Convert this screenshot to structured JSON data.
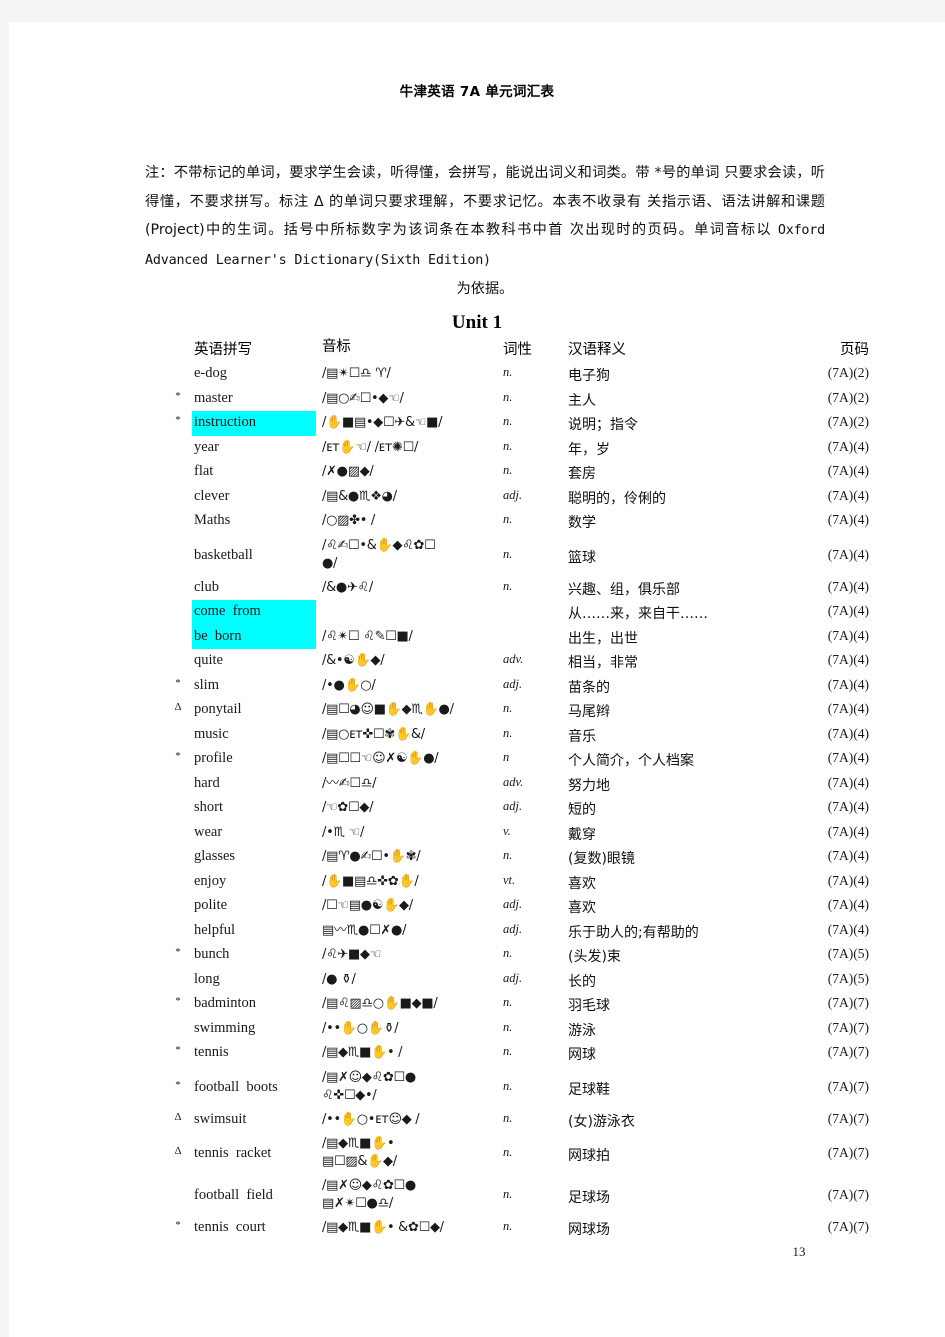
{
  "document": {
    "title": "牛津英语 7A 单元词汇表",
    "page_number": "13",
    "note": {
      "line1": "注：不带标记的单词，要求学生会读，听得懂，会拼写，能说出词义和词类。带 *号的单词",
      "line2": "只要求会读，听得懂，不要求拼写。标注 Δ 的单词只要求理解，不要求记忆。本表不收录有",
      "line3": "关指示语、语法讲解和课题(Project)中的生词。括号中所标数字为该词条在本教科书中首",
      "line4_pre": "次出现时的页码。单词音标以 ",
      "line4_mono": "Oxford Advanced Learner's Dictionary(Sixth Edition)",
      "line5": "为依据。"
    }
  },
  "unit": {
    "heading": "Unit 1"
  },
  "table": {
    "headers": {
      "mark": "",
      "word": "英语拼写",
      "phonetic": "音标",
      "pos": "词性",
      "meaning": "汉语释义",
      "page": "页码"
    },
    "highlight_color": "#00ffff",
    "rows": [
      {
        "mark": "",
        "word": "e-dog",
        "phonetic": "/▤✴☐♎  ♈/",
        "pos": "n.",
        "meaning": "电子狗",
        "page": "(7A)(2)",
        "highlight": false
      },
      {
        "mark": "*",
        "word": "master",
        "phonetic": "/▤○✍☐•◆☜/",
        "pos": "n.",
        "meaning": "主人",
        "page": "(7A)(2)",
        "highlight": false
      },
      {
        "mark": "*",
        "word": "instruction",
        "phonetic": "/✋■▤•◆☐✈&☜■/",
        "pos": "n.",
        "meaning": "说明；指令",
        "page": "(7A)(2)",
        "highlight": true
      },
      {
        "mark": "",
        "word": "year",
        "phonetic": "/ᴇᴛ✋☜/ /ᴇᴛ✺☐/",
        "pos": "n.",
        "meaning": "年，岁",
        "page": "(7A)(4)",
        "highlight": false
      },
      {
        "mark": "",
        "word": "flat",
        "phonetic": "/✗●▨◆/",
        "pos": "n.",
        "meaning": "套房",
        "page": "(7A)(4)",
        "highlight": false
      },
      {
        "mark": "",
        "word": "clever",
        "phonetic": "/▤&●♏❖◕/",
        "pos": "adj.",
        "meaning": "聪明的，伶俐的",
        "page": "(7A)(4)",
        "highlight": false
      },
      {
        "mark": "",
        "word": "Maths",
        "phonetic": "/○▨✤• /",
        "pos": "n.",
        "meaning": "数学",
        "page": "(7A)(4)",
        "highlight": false
      },
      {
        "mark": "",
        "word": "basketball",
        "phonetic": "/♌✍☐•&✋◆♌✿☐\n●/",
        "pos": "n.",
        "meaning": "篮球",
        "page": "(7A)(4)",
        "highlight": false
      },
      {
        "mark": "",
        "word": "club",
        "phonetic": "/&●✈♌/",
        "pos": "n.",
        "meaning": "兴趣、组，俱乐部",
        "page": "(7A)(4)",
        "highlight": false
      },
      {
        "mark": "",
        "word": "come  from",
        "phonetic": "",
        "pos": "",
        "meaning": "从……来，来自干……",
        "page": "(7A)(4)",
        "highlight": true
      },
      {
        "mark": "",
        "word": "be  born",
        "phonetic": "/♌✴☐ ♌✎☐■/",
        "pos": "",
        "meaning": "出生，出世",
        "page": "(7A)(4)",
        "highlight": true
      },
      {
        "mark": "",
        "word": "quite",
        "phonetic": "/&•☯✋◆/",
        "pos": "adv.",
        "meaning": "相当，非常",
        "page": "(7A)(4)",
        "highlight": false
      },
      {
        "mark": "*",
        "word": "slim",
        "phonetic": "/•●✋○/",
        "pos": "adj.",
        "meaning": "苗条的",
        "page": "(7A)(4)",
        "highlight": false
      },
      {
        "mark": "Δ",
        "word": "ponytail",
        "phonetic": "/▤☐◕☺■✋◆♏✋●/",
        "pos": "n.",
        "meaning": "马尾辫",
        "page": "(7A)(4)",
        "highlight": false
      },
      {
        "mark": "",
        "word": "music",
        "phonetic": "/▤○ᴇᴛ✜☐✾✋&/",
        "pos": "n.",
        "meaning": "音乐",
        "page": "(7A)(4)",
        "highlight": false
      },
      {
        "mark": "*",
        "word": "profile",
        "phonetic": "/▤☐☐☜☺✗☯✋●/",
        "pos": "n",
        "meaning": "个人简介，个人档案",
        "page": "(7A)(4)",
        "highlight": false
      },
      {
        "mark": "",
        "word": "hard",
        "phonetic": "/〰✍☐♎/",
        "pos": "adv.",
        "meaning": "努力地",
        "page": "(7A)(4)",
        "highlight": false
      },
      {
        "mark": "",
        "word": "short",
        "phonetic": "/☜✿☐◆/",
        "pos": "adj.",
        "meaning": "短的",
        "page": "(7A)(4)",
        "highlight": false
      },
      {
        "mark": "",
        "word": "wear",
        "phonetic": "/•♏ ☜/",
        "pos": "v.",
        "meaning": "戴穿",
        "page": "(7A)(4)",
        "highlight": false
      },
      {
        "mark": "",
        "word": "glasses",
        "phonetic": "/▤♈●✍☐•✋✾/",
        "pos": "n.",
        "meaning": "(复数)眼镜",
        "page": "(7A)(4)",
        "highlight": false
      },
      {
        "mark": "",
        "word": "enjoy",
        "phonetic": "/✋■▤♎✜✿✋/",
        "pos": "vt.",
        "meaning": "喜欢",
        "page": "(7A)(4)",
        "highlight": false
      },
      {
        "mark": "",
        "word": "polite",
        "phonetic": "/☐☜▤●☯✋◆/",
        "pos": "adj.",
        "meaning": "喜欢",
        "page": "(7A)(4)",
        "highlight": false
      },
      {
        "mark": "",
        "word": "helpful",
        "phonetic": "▤〰♏●☐✗●/",
        "pos": "adj.",
        "meaning": "乐于助人的;有帮助的",
        "page": "(7A)(4)",
        "highlight": false
      },
      {
        "mark": "*",
        "word": "bunch",
        "phonetic": "/♌✈■◆☜",
        "pos": "n.",
        "meaning": "(头发)束",
        "page": "(7A)(5)",
        "highlight": false
      },
      {
        "mark": "",
        "word": "long",
        "phonetic": "/●  ⚱/",
        "pos": "adj.",
        "meaning": "长的",
        "page": "(7A)(5)",
        "highlight": false
      },
      {
        "mark": "*",
        "word": "badminton",
        "phonetic": "/▤♌▨♎○✋■◆■/",
        "pos": "n.",
        "meaning": "羽毛球",
        "page": "(7A)(7)",
        "highlight": false
      },
      {
        "mark": "",
        "word": "swimming",
        "phonetic": "/••✋○✋⚱/",
        "pos": "n.",
        "meaning": "游泳",
        "page": "(7A)(7)",
        "highlight": false
      },
      {
        "mark": "*",
        "word": "tennis",
        "phonetic": "/▤◆♏■✋• /",
        "pos": "n.",
        "meaning": "网球",
        "page": "(7A)(7)",
        "highlight": false
      },
      {
        "mark": "*",
        "word": "football  boots",
        "phonetic": "/▤✗☺◆♌✿☐●\n♌✜☐◆•/",
        "pos": "n.",
        "meaning": "足球鞋",
        "page": "(7A)(7)",
        "highlight": false
      },
      {
        "mark": "Δ",
        "word": "swimsuit",
        "phonetic": "/••✋○•ᴇᴛ☺◆ /",
        "pos": "n.",
        "meaning": "(女)游泳衣",
        "page": "(7A)(7)",
        "highlight": false
      },
      {
        "mark": "Δ",
        "word": "tennis  racket",
        "phonetic": "/▤◆♏■✋•\n▤☐▨&✋◆/",
        "pos": "n.",
        "meaning": "网球拍",
        "page": "(7A)(7)",
        "highlight": false
      },
      {
        "mark": "",
        "word": "football  field",
        "phonetic": "/▤✗☺◆♌✿☐●\n▤✗✴☐●♎/",
        "pos": "n.",
        "meaning": "足球场",
        "page": "(7A)(7)",
        "highlight": false
      },
      {
        "mark": "*",
        "word": "tennis  court",
        "phonetic": "/▤◆♏■✋•  &✿☐◆/",
        "pos": "n.",
        "meaning": "网球场",
        "page": "(7A)(7)",
        "highlight": false
      }
    ]
  }
}
